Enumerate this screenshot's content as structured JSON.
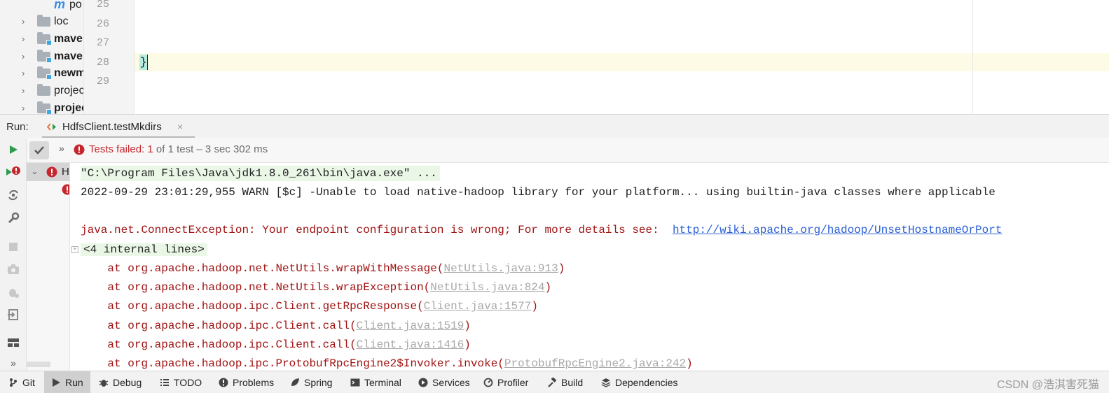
{
  "project_tree": {
    "items": [
      {
        "type": "file",
        "label": "po"
      },
      {
        "type": "folder",
        "label": "loc",
        "bold": false,
        "module": false
      },
      {
        "type": "folder",
        "label": "mave",
        "bold": true,
        "module": true
      },
      {
        "type": "folder",
        "label": "mave",
        "bold": true,
        "module": true
      },
      {
        "type": "folder",
        "label": "newm",
        "bold": true,
        "module": true
      },
      {
        "type": "folder",
        "label": "projec",
        "bold": false,
        "module": false
      },
      {
        "type": "folder",
        "label": "projec",
        "bold": true,
        "module": true
      }
    ]
  },
  "editor": {
    "line_numbers": [
      "25",
      "26",
      "27",
      "28",
      "29"
    ],
    "code_brace": "}"
  },
  "run_panel": {
    "label": "Run:",
    "tab_title": "HdfsClient.testMkdirs",
    "tab_close": "×",
    "status_failed": "Tests failed: 1",
    "status_rest": " of 1 test – 3 sec 302 ms",
    "more_glyph": "»",
    "test_node_label": "H"
  },
  "console": {
    "cmd_line": "\"C:\\Program Files\\Java\\jdk1.8.0_261\\bin\\java.exe\" ...",
    "warn_line": "2022-09-29 23:01:29,955 WARN [$c] -Unable to load native-hadoop library for your platform... using builtin-java classes where applicable",
    "exception_text": "java.net.ConnectException: Your endpoint configuration is wrong; For more details see:  ",
    "exception_link": "http://wiki.apache.org/hadoop/UnsetHostnameOrPort",
    "internal_lines": "<4 internal lines>",
    "stack": [
      {
        "method": "    at org.apache.hadoop.net.NetUtils.wrapWithMessage(",
        "source": "NetUtils.java:913"
      },
      {
        "method": "    at org.apache.hadoop.net.NetUtils.wrapException(",
        "source": "NetUtils.java:824"
      },
      {
        "method": "    at org.apache.hadoop.ipc.Client.getRpcResponse(",
        "source": "Client.java:1577"
      },
      {
        "method": "    at org.apache.hadoop.ipc.Client.call(",
        "source": "Client.java:1519"
      },
      {
        "method": "    at org.apache.hadoop.ipc.Client.call(",
        "source": "Client.java:1416"
      },
      {
        "method": "    at org.apache.hadoop.ipc.ProtobufRpcEngine2$Invoker.invoke(",
        "source": "ProtobufRpcEngine2.java:242"
      }
    ]
  },
  "bottom_bar": {
    "items": [
      {
        "label": "Git",
        "icon": "git-branch-icon"
      },
      {
        "label": "Run",
        "icon": "run-icon",
        "active": true
      },
      {
        "label": "Debug",
        "icon": "bug-icon"
      },
      {
        "label": "TODO",
        "icon": "list-icon"
      },
      {
        "label": "Problems",
        "icon": "info-icon"
      },
      {
        "label": "Spring",
        "icon": "leaf-icon"
      },
      {
        "label": "Terminal",
        "icon": "terminal-icon"
      },
      {
        "label": "Services",
        "icon": "services-icon"
      },
      {
        "label": "Profiler",
        "icon": "profiler-icon"
      },
      {
        "label": "Build",
        "icon": "hammer-icon"
      },
      {
        "label": "Dependencies",
        "icon": "layers-icon"
      }
    ],
    "watermark": "CSDN @浩淇害死猫"
  },
  "colors": {
    "error_red": "#c6272f",
    "exception_text": "#a11212",
    "link_blue": "#2a5fd4",
    "run_green": "#2e9c4e",
    "module_blue": "#3fa7e0"
  }
}
